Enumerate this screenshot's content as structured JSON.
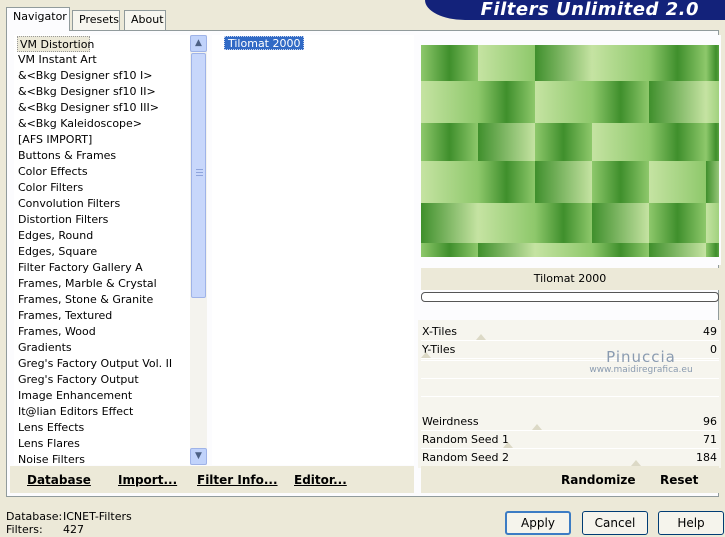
{
  "tabs": [
    "Navigator",
    "Presets",
    "About"
  ],
  "banner_title": "Filters Unlimited 2.0",
  "categories": [
    "VM Distortion",
    "VM Instant Art",
    "&<Bkg Designer sf10 I>",
    "&<Bkg Designer sf10 II>",
    "&<Bkg Designer sf10 III>",
    "&<Bkg Kaleidoscope>",
    "[AFS IMPORT]",
    "Buttons & Frames",
    "Color Effects",
    "Color Filters",
    "Convolution Filters",
    "Distortion Filters",
    "Edges, Round",
    "Edges, Square",
    "Filter Factory Gallery A",
    "Frames, Marble & Crystal",
    "Frames, Stone & Granite",
    "Frames, Textured",
    "Frames, Wood",
    "Gradients",
    "Greg's Factory Output Vol. II",
    "Greg's Factory Output",
    "Image Enhancement",
    "It@lian Editors Effect",
    "Lens Effects",
    "Lens Flares",
    "Noise Filters"
  ],
  "selected_category": "VM Distortion",
  "filters": [
    "Tilomat 2000"
  ],
  "selected_filter": "Tilomat 2000",
  "links": {
    "database": "Database",
    "import": "Import...",
    "filter_info": "Filter Info...",
    "editor": "Editor..."
  },
  "preview_filter_name": "Tilomat 2000",
  "params": [
    {
      "label": "X-Tiles",
      "value": "49",
      "level": 0.19
    },
    {
      "label": "Y-Tiles",
      "value": "0",
      "level": 0.0
    },
    {
      "label": "Weirdness",
      "value": "96",
      "level": 0.38
    },
    {
      "label": "Random Seed 1",
      "value": "71",
      "level": 0.28
    },
    {
      "label": "Random Seed 2",
      "value": "184",
      "level": 0.72
    }
  ],
  "watermark": {
    "name": "Pinuccia",
    "site": "www.maidiregrafica.eu"
  },
  "actions": {
    "randomize": "Randomize",
    "reset": "Reset"
  },
  "buttons": {
    "apply": "Apply",
    "cancel": "Cancel",
    "help": "Help"
  },
  "status": {
    "database_label": "Database:",
    "database_value": "ICNET-Filters",
    "filters_label": "Filters:",
    "filters_value": "427"
  },
  "colors": {
    "banner": "#13227a",
    "selection": "#316ac5",
    "preview_light": "#c5e3a2",
    "preview_mid": "#8ec86b",
    "preview_dark": "#3f8f2c"
  }
}
